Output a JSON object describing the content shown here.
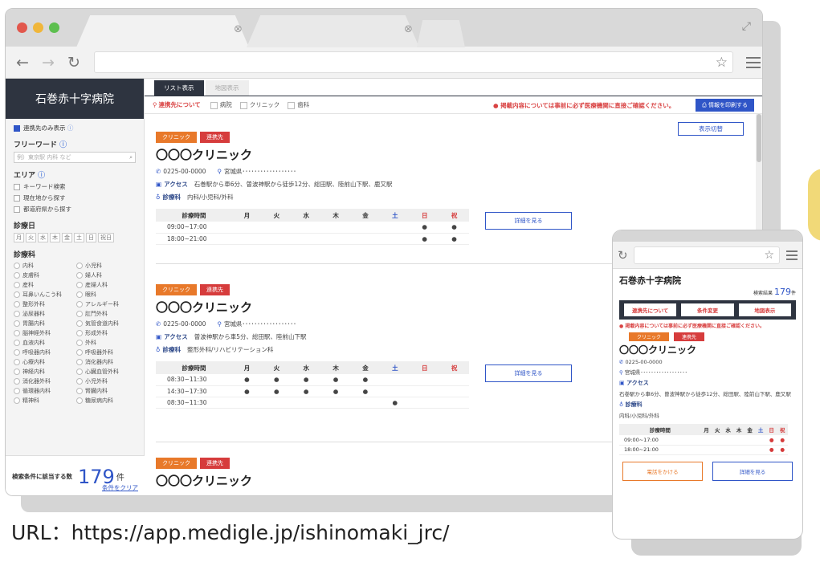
{
  "desktop": {
    "tab1_close": "⊗",
    "tab2_close": "⊗",
    "hospital_name": "石巻赤十字病院",
    "main_tabs": [
      {
        "label": "リスト表示"
      },
      {
        "label": "地図表示"
      }
    ],
    "filter": {
      "relation_label": "連携先について",
      "options": [
        "病院",
        "クリニック",
        "歯科"
      ],
      "notice": "掲載内容については事前に必ず医療機関に直接ご確認ください。",
      "print_label": "情報を印刷する"
    },
    "toggle_label": "表示切替",
    "sidebar": {
      "only_related": "連携先のみ表示",
      "freeword_label": "フリーワード",
      "freeword_placeholder": "例）東京駅 内科 など",
      "area_label": "エリア",
      "area_options": [
        "キーワード検索",
        "現在地から探す",
        "都道府県から探す"
      ],
      "days_label": "診療日",
      "days": [
        "月",
        "火",
        "水",
        "木",
        "金",
        "土",
        "日",
        "祝日"
      ],
      "dept_label": "診療科",
      "depts": [
        "内科",
        "小児科",
        "皮膚科",
        "婦人科",
        "産科",
        "産婦人科",
        "耳鼻いんこう科",
        "眼科",
        "整形外科",
        "アレルギー科",
        "泌尿器科",
        "肛門外科",
        "胃腸内科",
        "気管食道内科",
        "脳神経外科",
        "形成外科",
        "血液内科",
        "外科",
        "呼吸器内科",
        "呼吸器外科",
        "心療内科",
        "消化器内科",
        "神経内科",
        "心臓血管外科",
        "消化器外科",
        "小児外科",
        "循環器内科",
        "腎臓内科",
        "精神科",
        "糖尿病内科"
      ],
      "footer_label": "検索条件に該当する数",
      "count": "179",
      "unit": "件",
      "clear": "条件をクリア"
    },
    "cards": [
      {
        "badge_clinic": "クリニック",
        "badge_rel": "連携先",
        "name": "〇〇〇クリニック",
        "phone": "0225-00-0000",
        "address": "宮城県･･････････････････",
        "access_label": "アクセス",
        "access": "石巻駅から車6分、曽波神駅から徒歩12分、総田駅、陸前山下駅、鹿又駅",
        "dept_label": "診療科",
        "dept": "内科/小児科/外科",
        "sched_head": [
          "診療時間",
          "月",
          "火",
          "水",
          "木",
          "金",
          "土",
          "日",
          "祝"
        ],
        "rows": [
          {
            "time": "09:00~17:00",
            "marks": [
              "",
              "",
              "",
              "",
              "",
              "",
              "●",
              "●"
            ]
          },
          {
            "time": "18:00~21:00",
            "marks": [
              "",
              "",
              "",
              "",
              "",
              "",
              "●",
              "●"
            ]
          }
        ],
        "detail": "詳細を見る"
      },
      {
        "badge_clinic": "クリニック",
        "badge_rel": "連携先",
        "name": "〇〇〇クリニック",
        "phone": "0225-00-0000",
        "address": "宮城県･･････････････････",
        "access_label": "アクセス",
        "access": "曽波神駅から車5分、総田駅、陸前山下駅",
        "dept_label": "診療科",
        "dept": "整形外科/リハビリテーション科",
        "sched_head": [
          "診療時間",
          "月",
          "火",
          "水",
          "木",
          "金",
          "土",
          "日",
          "祝"
        ],
        "rows": [
          {
            "time": "08:30~11:30",
            "marks": [
              "●",
              "●",
              "●",
              "●",
              "●",
              "",
              "",
              ""
            ]
          },
          {
            "time": "14:30~17:30",
            "marks": [
              "●",
              "●",
              "●",
              "●",
              "●",
              "",
              "",
              ""
            ]
          },
          {
            "time": "08:30~11:30",
            "marks": [
              "",
              "",
              "",
              "",
              "",
              "●",
              "",
              ""
            ]
          }
        ],
        "detail": "詳細を見る"
      },
      {
        "badge_clinic": "クリニック",
        "badge_rel": "連携先",
        "name": "〇〇〇クリニック"
      }
    ]
  },
  "mobile": {
    "hospital_name": "石巻赤十字病院",
    "count_label": "検索結果",
    "count": "179",
    "unit": "件",
    "buttons": [
      "連携先について",
      "条件変更",
      "地図表示"
    ],
    "notice": "掲載内容については事前に必ず医療機関に直接ご確認ください。",
    "badge_clinic": "クリニック",
    "badge_rel": "連携先",
    "name": "〇〇〇クリニック",
    "phone": "0225-00-0000",
    "address": "宮城県･･････････････････",
    "access_label": "アクセス",
    "access": "石巻駅から車6分、曽波神駅から徒歩12分、総田駅、陸前山下駅、鹿又駅",
    "dept_label": "診療科",
    "dept": "内科/小児科/外科",
    "sched_head": [
      "診療時間",
      "月",
      "火",
      "水",
      "木",
      "金",
      "土",
      "日",
      "祝"
    ],
    "rows": [
      {
        "time": "09:00~17:00",
        "marks": [
          "",
          "",
          "",
          "",
          "",
          "",
          "●",
          "●"
        ]
      },
      {
        "time": "18:00~21:00",
        "marks": [
          "",
          "",
          "",
          "",
          "",
          "",
          "●",
          "●"
        ]
      }
    ],
    "call": "電話をかける",
    "detail": "詳細を見る"
  },
  "caption": "URL：https://app.medigle.jp/ishinomaki_jrc/",
  "colors": {
    "accent": "#2f55c7",
    "navy": "#2e3440",
    "orange": "#e8792a",
    "red": "#d63c3c"
  }
}
